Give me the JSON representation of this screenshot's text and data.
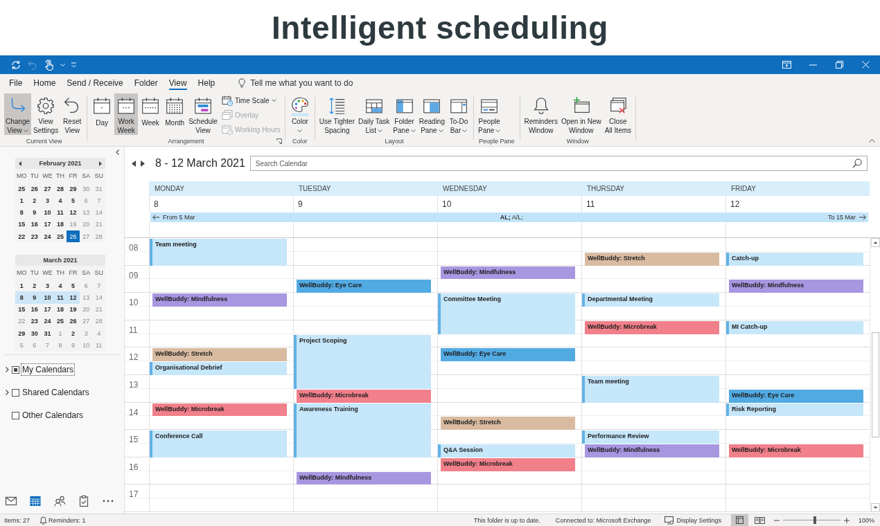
{
  "headline": "Intelligent scheduling",
  "title_bar": {
    "quick_access": [
      {
        "kind": "sync",
        "disabled": false
      },
      {
        "kind": "undo",
        "disabled": true
      },
      {
        "kind": "touch",
        "disabled": false
      }
    ]
  },
  "menu_tabs": [
    {
      "label": "File",
      "selected": false
    },
    {
      "label": "Home",
      "selected": false
    },
    {
      "label": "Send / Receive",
      "selected": false
    },
    {
      "label": "Folder",
      "selected": false
    },
    {
      "label": "View",
      "selected": true
    },
    {
      "label": "Help",
      "selected": false
    }
  ],
  "tell_me": {
    "placeholder": "Tell me what you want to do"
  },
  "ribbon": {
    "groups": [
      {
        "label": "Current View",
        "launcher": false,
        "buttons": [
          {
            "kind": "change_view",
            "lines": [
              "Change",
              "View"
            ],
            "dropdown": true,
            "selected": true
          },
          {
            "kind": "view_settings",
            "lines": [
              "View",
              "Settings"
            ],
            "dropdown": false,
            "selected": false
          },
          {
            "kind": "reset_view",
            "lines": [
              "Reset",
              "View"
            ],
            "dropdown": false,
            "selected": false
          }
        ]
      },
      {
        "label": "Arrangement",
        "launcher": true,
        "buttons": [
          {
            "kind": "day",
            "lines": [
              "Day"
            ],
            "dropdown": false,
            "selected": false
          },
          {
            "kind": "work_week",
            "lines": [
              "Work",
              "Week"
            ],
            "dropdown": false,
            "selected": true
          },
          {
            "kind": "week",
            "lines": [
              "Week"
            ],
            "dropdown": false,
            "selected": false
          },
          {
            "kind": "month",
            "lines": [
              "Month"
            ],
            "dropdown": false,
            "selected": false
          },
          {
            "kind": "schedule_view",
            "lines": [
              "Schedule",
              "View"
            ],
            "dropdown": false,
            "selected": false
          }
        ],
        "small_buttons": [
          {
            "kind": "time_scale",
            "label": "Time Scale",
            "dropdown": true,
            "disabled": false
          },
          {
            "kind": "overlay",
            "label": "Overlay",
            "dropdown": false,
            "disabled": true
          },
          {
            "kind": "working_hours",
            "label": "Working Hours",
            "dropdown": false,
            "disabled": true
          }
        ]
      },
      {
        "label": "Color",
        "launcher": false,
        "buttons": [
          {
            "kind": "color",
            "lines": [
              "Color"
            ],
            "dropdown": true,
            "selected": false
          }
        ]
      },
      {
        "label": "Layout",
        "launcher": false,
        "buttons": [
          {
            "kind": "tighter_spacing",
            "lines": [
              "Use Tighter",
              "Spacing"
            ],
            "dropdown": false,
            "selected": false
          },
          {
            "kind": "daily_task_list",
            "lines": [
              "Daily Task",
              "List"
            ],
            "dropdown": true,
            "selected": false
          },
          {
            "kind": "folder_pane",
            "lines": [
              "Folder",
              "Pane"
            ],
            "dropdown": true,
            "selected": false
          },
          {
            "kind": "reading_pane",
            "lines": [
              "Reading",
              "Pane"
            ],
            "dropdown": true,
            "selected": false
          },
          {
            "kind": "to_do_bar",
            "lines": [
              "To-Do",
              "Bar"
            ],
            "dropdown": true,
            "selected": false
          }
        ]
      },
      {
        "label": "People Pane",
        "launcher": false,
        "buttons": [
          {
            "kind": "people_pane",
            "lines": [
              "People",
              "Pane"
            ],
            "dropdown": true,
            "selected": false
          }
        ]
      },
      {
        "label": "Window",
        "launcher": false,
        "buttons": [
          {
            "kind": "reminders_window",
            "lines": [
              "Reminders",
              "Window"
            ],
            "dropdown": false,
            "selected": false
          },
          {
            "kind": "open_new_window",
            "lines": [
              "Open in New",
              "Window"
            ],
            "dropdown": false,
            "selected": false
          },
          {
            "kind": "close_all_items",
            "lines": [
              "Close",
              "All Items"
            ],
            "dropdown": false,
            "selected": false
          }
        ]
      }
    ]
  },
  "sidebar": {
    "mini_calendars": [
      {
        "title": "February 2021",
        "nav": true,
        "weekdays": [
          "MO",
          "TU",
          "WE",
          "TH",
          "FR",
          "SA",
          "SU"
        ],
        "weeks": [
          [
            {
              "text": "25",
              "bold": true,
              "selected": false,
              "today": false
            },
            {
              "text": "26",
              "bold": true,
              "selected": false,
              "today": false
            },
            {
              "text": "27",
              "bold": true,
              "selected": false,
              "today": false
            },
            {
              "text": "28",
              "bold": true,
              "selected": false,
              "today": false
            },
            {
              "text": "29",
              "bold": true,
              "selected": false,
              "today": false
            },
            {
              "text": "30",
              "bold": false,
              "selected": false,
              "today": false
            },
            {
              "text": "31",
              "bold": false,
              "selected": false,
              "today": false
            }
          ],
          [
            {
              "text": "1",
              "bold": true,
              "selected": false,
              "today": false
            },
            {
              "text": "2",
              "bold": true,
              "selected": false,
              "today": false
            },
            {
              "text": "3",
              "bold": true,
              "selected": false,
              "today": false
            },
            {
              "text": "4",
              "bold": true,
              "selected": false,
              "today": false
            },
            {
              "text": "5",
              "bold": true,
              "selected": false,
              "today": false
            },
            {
              "text": "6",
              "bold": false,
              "selected": false,
              "today": false
            },
            {
              "text": "7",
              "bold": false,
              "selected": false,
              "today": false
            }
          ],
          [
            {
              "text": "8",
              "bold": true,
              "selected": false,
              "today": false
            },
            {
              "text": "9",
              "bold": true,
              "selected": false,
              "today": false
            },
            {
              "text": "10",
              "bold": true,
              "selected": false,
              "today": false
            },
            {
              "text": "11",
              "bold": true,
              "selected": false,
              "today": false
            },
            {
              "text": "12",
              "bold": true,
              "selected": false,
              "today": false
            },
            {
              "text": "13",
              "bold": false,
              "selected": false,
              "today": false
            },
            {
              "text": "14",
              "bold": false,
              "selected": false,
              "today": false
            }
          ],
          [
            {
              "text": "15",
              "bold": true,
              "selected": false,
              "today": false
            },
            {
              "text": "16",
              "bold": true,
              "selected": false,
              "today": false
            },
            {
              "text": "17",
              "bold": true,
              "selected": false,
              "today": false
            },
            {
              "text": "18",
              "bold": true,
              "selected": false,
              "today": false
            },
            {
              "text": "19",
              "bold": false,
              "selected": false,
              "today": false
            },
            {
              "text": "20",
              "bold": false,
              "selected": false,
              "today": false
            },
            {
              "text": "21",
              "bold": false,
              "selected": false,
              "today": false
            }
          ],
          [
            {
              "text": "22",
              "bold": true,
              "selected": false,
              "today": false
            },
            {
              "text": "23",
              "bold": true,
              "selected": false,
              "today": false
            },
            {
              "text": "24",
              "bold": true,
              "selected": false,
              "today": false
            },
            {
              "text": "25",
              "bold": true,
              "selected": false,
              "today": false
            },
            {
              "text": "26",
              "bold": false,
              "selected": false,
              "today": true
            },
            {
              "text": "27",
              "bold": false,
              "selected": false,
              "today": false
            },
            {
              "text": "28",
              "bold": false,
              "selected": false,
              "today": false
            }
          ]
        ]
      },
      {
        "title": "March 2021",
        "nav": false,
        "weekdays": [
          "MO",
          "TU",
          "WE",
          "TH",
          "FR",
          "SA",
          "SU"
        ],
        "weeks": [
          [
            {
              "text": "1",
              "bold": true,
              "selected": false,
              "today": false
            },
            {
              "text": "2",
              "bold": true,
              "selected": false,
              "today": false
            },
            {
              "text": "3",
              "bold": true,
              "selected": false,
              "today": false
            },
            {
              "text": "4",
              "bold": true,
              "selected": false,
              "today": false
            },
            {
              "text": "5",
              "bold": true,
              "selected": false,
              "today": false
            },
            {
              "text": "6",
              "bold": false,
              "selected": false,
              "today": false
            },
            {
              "text": "7",
              "bold": false,
              "selected": false,
              "today": false
            }
          ],
          [
            {
              "text": "8",
              "bold": true,
              "selected": true,
              "today": false
            },
            {
              "text": "9",
              "bold": true,
              "selected": true,
              "today": false
            },
            {
              "text": "10",
              "bold": true,
              "selected": true,
              "today": false
            },
            {
              "text": "11",
              "bold": true,
              "selected": true,
              "today": false
            },
            {
              "text": "12",
              "bold": true,
              "selected": true,
              "today": false
            },
            {
              "text": "13",
              "bold": false,
              "selected": false,
              "today": false
            },
            {
              "text": "14",
              "bold": false,
              "selected": false,
              "today": false
            }
          ],
          [
            {
              "text": "15",
              "bold": true,
              "selected": false,
              "today": false
            },
            {
              "text": "16",
              "bold": true,
              "selected": false,
              "today": false
            },
            {
              "text": "17",
              "bold": true,
              "selected": false,
              "today": false
            },
            {
              "text": "18",
              "bold": true,
              "selected": false,
              "today": false
            },
            {
              "text": "19",
              "bold": true,
              "selected": false,
              "today": false
            },
            {
              "text": "20",
              "bold": false,
              "selected": false,
              "today": false
            },
            {
              "text": "21",
              "bold": false,
              "selected": false,
              "today": false
            }
          ],
          [
            {
              "text": "22",
              "bold": false,
              "selected": false,
              "today": false
            },
            {
              "text": "23",
              "bold": true,
              "selected": false,
              "today": false
            },
            {
              "text": "24",
              "bold": true,
              "selected": false,
              "today": false
            },
            {
              "text": "25",
              "bold": true,
              "selected": false,
              "today": false
            },
            {
              "text": "26",
              "bold": true,
              "selected": false,
              "today": false
            },
            {
              "text": "27",
              "bold": false,
              "selected": false,
              "today": false
            },
            {
              "text": "28",
              "bold": false,
              "selected": false,
              "today": false
            }
          ],
          [
            {
              "text": "29",
              "bold": true,
              "selected": false,
              "today": false
            },
            {
              "text": "30",
              "bold": true,
              "selected": false,
              "today": false
            },
            {
              "text": "31",
              "bold": true,
              "selected": false,
              "today": false
            },
            {
              "text": "1",
              "bold": false,
              "selected": false,
              "today": false
            },
            {
              "text": "2",
              "bold": true,
              "selected": false,
              "today": false
            },
            {
              "text": "3",
              "bold": false,
              "selected": false,
              "today": false
            },
            {
              "text": "4",
              "bold": false,
              "selected": false,
              "today": false
            }
          ],
          [
            {
              "text": "5",
              "bold": false,
              "selected": false,
              "today": false
            },
            {
              "text": "6",
              "bold": false,
              "selected": false,
              "today": false
            },
            {
              "text": "7",
              "bold": false,
              "selected": false,
              "today": false
            },
            {
              "text": "8",
              "bold": false,
              "selected": false,
              "today": false
            },
            {
              "text": "9",
              "bold": false,
              "selected": false,
              "today": false
            },
            {
              "text": "10",
              "bold": false,
              "selected": false,
              "today": false
            },
            {
              "text": "11",
              "bold": false,
              "selected": false,
              "today": false
            }
          ]
        ]
      }
    ],
    "folders": [
      {
        "label": "My Calendars",
        "checked": true,
        "expandable": true,
        "focused": true
      },
      {
        "label": "Shared Calendars",
        "checked": false,
        "expandable": true,
        "focused": false
      },
      {
        "label": "Other Calendars",
        "checked": false,
        "expandable": false,
        "focused": false
      }
    ],
    "nav": [
      {
        "kind": "mail",
        "selected": false
      },
      {
        "kind": "calendar",
        "selected": true
      },
      {
        "kind": "people",
        "selected": false
      },
      {
        "kind": "tasks",
        "selected": false
      },
      {
        "kind": "more",
        "selected": false
      }
    ]
  },
  "calendar": {
    "title": "8 - 12 March 2021",
    "search": {
      "placeholder": "Search Calendar"
    },
    "days": [
      {
        "name": "MONDAY",
        "date": "8"
      },
      {
        "name": "TUESDAY",
        "date": "9"
      },
      {
        "name": "WEDNESDAY",
        "date": "10"
      },
      {
        "name": "THURSDAY",
        "date": "11"
      },
      {
        "name": "FRIDAY",
        "date": "12"
      }
    ],
    "all_day": {
      "from": "From 5 Mar",
      "label": "**AL;** A/L;",
      "to": "To 15 Mar"
    },
    "slots": [
      {
        "hour": "08",
        "cells": [
          {
            "event": {
              "title": "Team meeting",
              "kind": "hour",
              "color": "#c6e6fa",
              "busy": true
            }
          },
          {},
          {},
          {},
          {}
        ]
      },
      {
        "cells": [
          {},
          {},
          {},
          {
            "event": {
              "title": "WellBuddy: Stretch",
              "kind": "halfhour",
              "color": "#d9bba1",
              "busy": false
            }
          },
          {
            "event": {
              "title": "Catch-up",
              "kind": "halfhour",
              "color": "#c6e6fa",
              "busy": true
            }
          }
        ]
      },
      {
        "hour": "09",
        "cells": [
          {},
          {},
          {
            "event": {
              "title": "WellBuddy: Mindfulness",
              "kind": "halfhour",
              "color": "#a796e0",
              "busy": false
            }
          },
          {},
          {}
        ]
      },
      {
        "cells": [
          {},
          {
            "event": {
              "title": "WellBuddy: Eye Care",
              "kind": "halfhour",
              "color": "#52aae3",
              "busy": false
            }
          },
          {},
          {},
          {
            "event": {
              "title": "WellBuddy: Mindfulness",
              "kind": "halfhour",
              "color": "#a796e0",
              "busy": false
            }
          }
        ]
      },
      {
        "hour": "10",
        "cells": [
          {
            "event": {
              "title": "WellBuddy: Mindfulness",
              "kind": "halfhour",
              "color": "#a796e0",
              "busy": false
            }
          },
          {},
          {
            "event": {
              "title": "Committee Meeting",
              "kind": "hourhalf",
              "color": "#c6e6fa",
              "busy": true
            }
          },
          {
            "event": {
              "title": "Departmental Meeting",
              "kind": "halfhour",
              "color": "#c6e6fa",
              "busy": true
            }
          },
          {}
        ]
      },
      {
        "cells": [
          {},
          {},
          {},
          {},
          {}
        ]
      },
      {
        "hour": "11",
        "cells": [
          {},
          {},
          {},
          {
            "event": {
              "title": "WellBuddy: Microbreak",
              "kind": "halfhour",
              "color": "#f1808b",
              "busy": false
            }
          },
          {
            "event": {
              "title": "MI Catch-up",
              "kind": "halfhour",
              "color": "#c6e6fa",
              "busy": true
            }
          }
        ]
      },
      {
        "cells": [
          {},
          {
            "event": {
              "title": "Project Scoping",
              "kind": "twohours",
              "color": "#c6e6fa",
              "busy": true
            }
          },
          {},
          {},
          {}
        ]
      },
      {
        "hour": "12",
        "cells": [
          {
            "event": {
              "title": "WellBuddy: Stretch",
              "kind": "halfhour",
              "color": "#d9bba1",
              "busy": false
            }
          },
          {},
          {
            "event": {
              "title": "WellBuddy: Eye Care",
              "kind": "halfhour",
              "color": "#52aae3",
              "busy": false
            }
          },
          {},
          {}
        ]
      },
      {
        "cells": [
          {
            "event": {
              "title": "Organisational Debrief",
              "kind": "halfhour",
              "color": "#c6e6fa",
              "busy": true
            }
          },
          {},
          {},
          {},
          {}
        ]
      },
      {
        "hour": "13",
        "cells": [
          {},
          {},
          {},
          {
            "event": {
              "title": "Team meeting",
              "kind": "hour",
              "color": "#c6e6fa",
              "busy": true
            }
          },
          {}
        ]
      },
      {
        "cells": [
          {},
          {
            "event": {
              "title": "WellBuddy: Microbreak",
              "kind": "halfhour",
              "color": "#f1808b",
              "busy": false
            }
          },
          {},
          {},
          {
            "event": {
              "title": "WellBuddy: Eye Care",
              "kind": "halfhour",
              "color": "#52aae3",
              "busy": false
            }
          }
        ]
      },
      {
        "hour": "14",
        "cells": [
          {
            "event": {
              "title": "WellBuddy: Microbreak",
              "kind": "halfhour",
              "color": "#f1808b",
              "busy": false
            }
          },
          {
            "event": {
              "title": "Awareness Training",
              "kind": "twohours",
              "color": "#c6e6fa",
              "busy": true
            }
          },
          {},
          {},
          {
            "event": {
              "title": "Risk Reporting",
              "kind": "halfhour",
              "color": "#c6e6fa",
              "busy": true
            }
          }
        ]
      },
      {
        "cells": [
          {},
          {},
          {
            "event": {
              "title": "WellBuddy: Stretch",
              "kind": "halfhour",
              "color": "#d9bba1",
              "busy": false
            }
          },
          {},
          {}
        ]
      },
      {
        "hour": "15",
        "cells": [
          {
            "event": {
              "title": "Conference Call",
              "kind": "hour",
              "color": "#c6e6fa",
              "busy": true
            }
          },
          {},
          {},
          {
            "event": {
              "title": "Performance Review",
              "kind": "halfhour",
              "color": "#c6e6fa",
              "busy": true
            }
          },
          {}
        ]
      },
      {
        "cells": [
          {},
          {},
          {
            "event": {
              "title": "Q&A Session",
              "kind": "halfhour",
              "color": "#c6e6fa",
              "busy": true
            }
          },
          {
            "event": {
              "title": "WellBuddy: Mindfulness",
              "kind": "halfhour",
              "color": "#a796e0",
              "busy": false
            }
          },
          {
            "event": {
              "title": "WellBuddy: Microbreak",
              "kind": "halfhour",
              "color": "#f1808b",
              "busy": false
            }
          }
        ]
      },
      {
        "hour": "16",
        "cells": [
          {},
          {},
          {
            "event": {
              "title": "WellBuddy: Microbreak",
              "kind": "halfhour",
              "color": "#f1808b",
              "busy": false
            }
          },
          {},
          {}
        ]
      },
      {
        "cells": [
          {},
          {
            "event": {
              "title": "WellBuddy: Mindfulness",
              "kind": "halfhour",
              "color": "#a796e0",
              "busy": false
            }
          },
          {},
          {},
          {}
        ]
      },
      {
        "hour": "17",
        "cells": [
          {},
          {},
          {},
          {},
          {}
        ]
      },
      {
        "cells": [
          {},
          {},
          {},
          {},
          {}
        ]
      }
    ]
  },
  "status_bar": {
    "items": "Items: 27",
    "reminders": "Reminders: 1",
    "sync_status": "This folder is up to date.",
    "connection": "Connected to: Microsoft Exchange",
    "display_settings": "Display Settings",
    "views": [
      {
        "kind": "normal",
        "selected": true
      },
      {
        "kind": "reading",
        "selected": false
      }
    ],
    "zoom": {
      "level": 0.55,
      "reading": "100%"
    }
  }
}
